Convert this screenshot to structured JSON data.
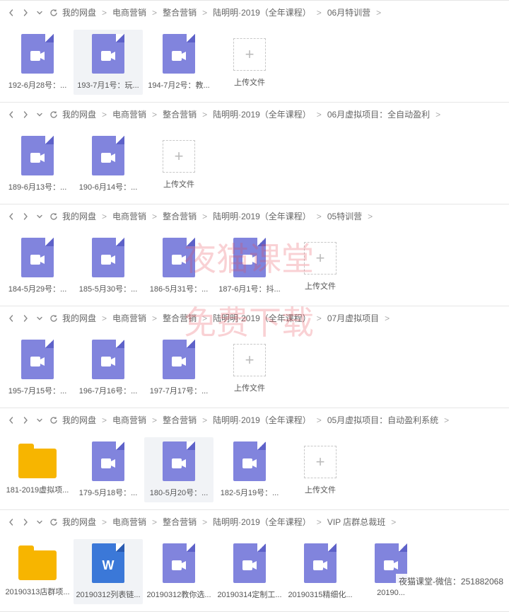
{
  "watermark": {
    "line1": "夜猫课堂",
    "line2": "免费下载"
  },
  "footer": "夜猫课堂-微信：251882068",
  "panels": [
    {
      "crumbs": [
        "我的网盘",
        "电商营销",
        "整合营销",
        "陆明明·2019（全年课程）",
        "06月特训营"
      ],
      "items": [
        {
          "kind": "video",
          "label": "192-6月28号：...",
          "sel": false
        },
        {
          "kind": "video",
          "label": "193-7月1号：玩...",
          "sel": true
        },
        {
          "kind": "video",
          "label": "194-7月2号：教...",
          "sel": false
        },
        {
          "kind": "upload",
          "label": "上传文件"
        }
      ]
    },
    {
      "crumbs": [
        "我的网盘",
        "电商营销",
        "整合营销",
        "陆明明·2019（全年课程）",
        "06月虚拟项目：全自动盈利"
      ],
      "items": [
        {
          "kind": "video",
          "label": "189-6月13号：...",
          "sel": false
        },
        {
          "kind": "video",
          "label": "190-6月14号：...",
          "sel": false
        },
        {
          "kind": "upload",
          "label": "上传文件"
        }
      ]
    },
    {
      "crumbs": [
        "我的网盘",
        "电商营销",
        "整合营销",
        "陆明明·2019（全年课程）",
        "05特训营"
      ],
      "items": [
        {
          "kind": "video",
          "label": "184-5月29号：...",
          "sel": false
        },
        {
          "kind": "video",
          "label": "185-5月30号：...",
          "sel": false
        },
        {
          "kind": "video",
          "label": "186-5月31号：...",
          "sel": false
        },
        {
          "kind": "video",
          "label": "187-6月1号：抖...",
          "sel": false
        },
        {
          "kind": "upload",
          "label": "上传文件"
        }
      ]
    },
    {
      "crumbs": [
        "我的网盘",
        "电商营销",
        "整合营销",
        "陆明明·2019（全年课程）",
        "07月虚拟项目"
      ],
      "items": [
        {
          "kind": "video",
          "label": "195-7月15号：...",
          "sel": false
        },
        {
          "kind": "video",
          "label": "196-7月16号：...",
          "sel": false
        },
        {
          "kind": "video",
          "label": "197-7月17号：...",
          "sel": false
        },
        {
          "kind": "upload",
          "label": "上传文件"
        }
      ]
    },
    {
      "crumbs": [
        "我的网盘",
        "电商营销",
        "整合营销",
        "陆明明·2019（全年课程）",
        "05月虚拟项目：自动盈利系统"
      ],
      "items": [
        {
          "kind": "folder",
          "label": "181-2019虚拟项...",
          "sel": false
        },
        {
          "kind": "video",
          "label": "179-5月18号：...",
          "sel": false
        },
        {
          "kind": "video",
          "label": "180-5月20号：...",
          "sel": true
        },
        {
          "kind": "video",
          "label": "182-5月19号：...",
          "sel": false
        },
        {
          "kind": "upload",
          "label": "上传文件"
        }
      ]
    },
    {
      "crumbs": [
        "我的网盘",
        "电商营销",
        "整合营销",
        "陆明明·2019（全年课程）",
        "VIP 店群总裁班"
      ],
      "items": [
        {
          "kind": "folder",
          "label": "20190313店群项...",
          "sel": false
        },
        {
          "kind": "word",
          "label": "20190312列表链...",
          "sel": true
        },
        {
          "kind": "video",
          "label": "20190312教你选...",
          "sel": false
        },
        {
          "kind": "video",
          "label": "20190314定制工...",
          "sel": false
        },
        {
          "kind": "video",
          "label": "20190315精细化...",
          "sel": false
        },
        {
          "kind": "video",
          "label": "20190...",
          "sel": false
        }
      ]
    }
  ]
}
